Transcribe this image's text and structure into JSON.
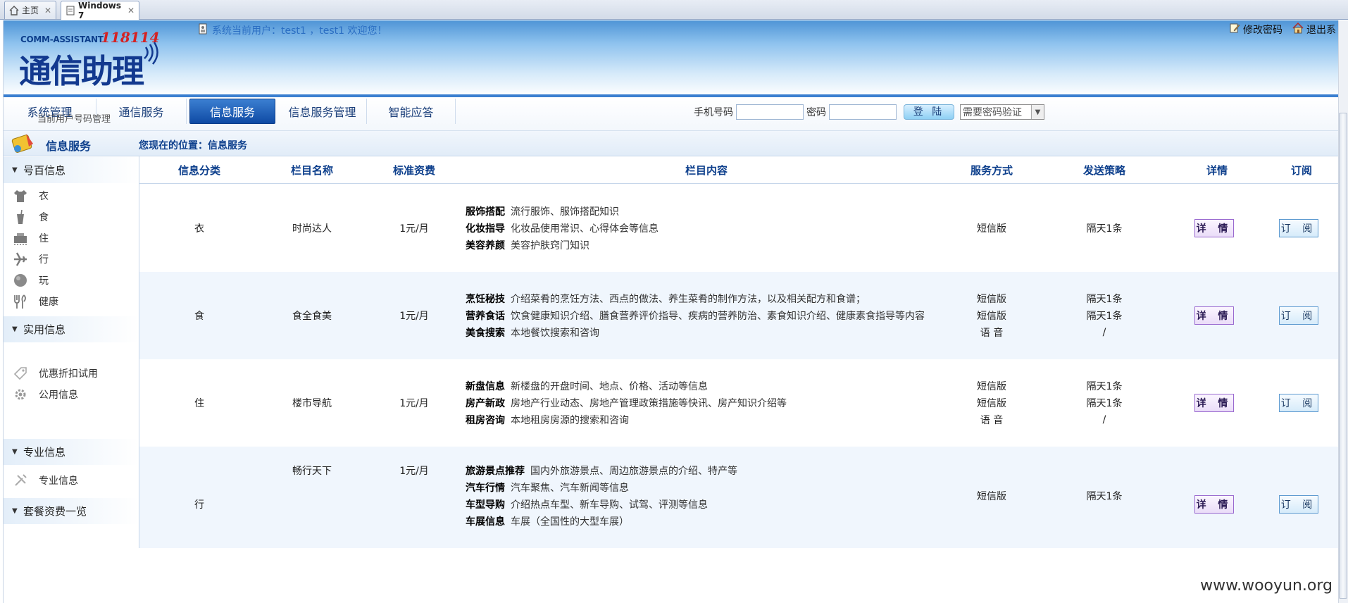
{
  "browser": {
    "tabs": [
      {
        "label": "主页",
        "icon": "home-icon"
      },
      {
        "label": "Windows 7",
        "icon": "page-icon"
      }
    ]
  },
  "header": {
    "logo_en": "COMM-ASSISTANT",
    "logo_num": "118114",
    "logo_cn": "通信助理",
    "welcome": "系统当前用户：test1 ，test1 欢迎您！",
    "change_password": "修改密码",
    "logout": "退出系"
  },
  "nav": {
    "tabs": [
      "系统管理",
      "通信服务",
      "信息服务",
      "信息服务管理",
      "智能应答"
    ],
    "active": "信息服务",
    "overlap_text": "当前用户号码管理"
  },
  "login": {
    "phone_label": "手机号码",
    "password_label": "密码",
    "button": "登 陆",
    "verify_option": "需要密码验证"
  },
  "breadcrumb": {
    "section_title": "信息服务",
    "location": "您现在的位置：信息服务"
  },
  "sidebar": {
    "sections": [
      {
        "title": "号百信息",
        "items": [
          {
            "label": "衣",
            "icon": "shirt-icon"
          },
          {
            "label": "食",
            "icon": "cup-icon"
          },
          {
            "label": "住",
            "icon": "bed-icon"
          },
          {
            "label": "行",
            "icon": "plane-icon"
          },
          {
            "label": "玩",
            "icon": "ball-icon"
          },
          {
            "label": "健康",
            "icon": "health-icon"
          }
        ]
      },
      {
        "title": "实用信息",
        "items": [
          {
            "label": "优惠折扣试用",
            "icon": "tag-icon"
          },
          {
            "label": "公用信息",
            "icon": "gear-icon"
          }
        ]
      },
      {
        "title": "专业信息",
        "items": [
          {
            "label": "专业信息",
            "icon": "tools-icon"
          }
        ]
      },
      {
        "title": "套餐资费一览",
        "items": []
      }
    ]
  },
  "table": {
    "headers": [
      "信息分类",
      "栏目名称",
      "标准资费",
      "栏目内容",
      "服务方式",
      "发送策略",
      "详情",
      "订阅"
    ],
    "detail_label": "详 情",
    "subscribe_label": "订 阅",
    "rows": [
      {
        "category": "衣",
        "name": "时尚达人",
        "fee": "1元/月",
        "content": [
          {
            "title": "服饰搭配",
            "desc": "流行服饰、服饰搭配知识"
          },
          {
            "title": "化妆指导",
            "desc": "化妆品使用常识、心得体会等信息"
          },
          {
            "title": "美容养颜",
            "desc": "美容护肤窍门知识"
          }
        ],
        "service": [
          "短信版"
        ],
        "strategy": [
          "隔天1条"
        ]
      },
      {
        "category": "食",
        "name": "食全食美",
        "fee": "1元/月",
        "content": [
          {
            "title": "烹饪秘技",
            "desc": "介绍菜肴的烹饪方法、西点的做法、养生菜肴的制作方法，以及相关配方和食谱；"
          },
          {
            "title": "营养食话",
            "desc": "饮食健康知识介绍、膳食营养评价指导、疾病的营养防治、素食知识介绍、健康素食指导等内容"
          },
          {
            "title": "美食搜索",
            "desc": "本地餐饮搜索和咨询"
          }
        ],
        "service": [
          "短信版",
          "短信版",
          "语 音"
        ],
        "strategy": [
          "隔天1条",
          "隔天1条",
          "/"
        ]
      },
      {
        "category": "住",
        "name": "楼市导航",
        "fee": "1元/月",
        "content": [
          {
            "title": "新盘信息",
            "desc": "新楼盘的开盘时间、地点、价格、活动等信息"
          },
          {
            "title": "房产新政",
            "desc": "房地产行业动态、房地产管理政策措施等快讯、房产知识介绍等"
          },
          {
            "title": "租房咨询",
            "desc": "本地租房房源的搜索和咨询"
          }
        ],
        "service": [
          "短信版",
          "短信版",
          "语 音"
        ],
        "strategy": [
          "隔天1条",
          "隔天1条",
          "/"
        ]
      },
      {
        "category": "行",
        "name": "畅行天下",
        "fee": "1元/月",
        "content": [
          {
            "title": "旅游景点推荐",
            "desc": "国内外旅游景点、周边旅游景点的介绍、特产等"
          },
          {
            "title": "汽车行情",
            "desc": "汽车聚焦、汽车新闻等信息"
          },
          {
            "title": "车型导购",
            "desc": "介绍热点车型、新车导购、试驾、评测等信息"
          },
          {
            "title": "车展信息",
            "desc": "车展（全国性的大型车展）"
          }
        ],
        "service": [
          "短信版"
        ],
        "strategy": [
          "隔天1条"
        ]
      }
    ]
  },
  "watermark": "www.wooyun.org"
}
